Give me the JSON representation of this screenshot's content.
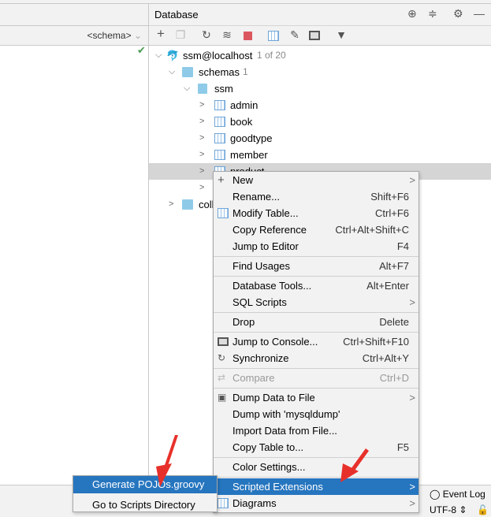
{
  "left": {
    "schema_selector": "<schema>"
  },
  "database": {
    "title": "Database",
    "tree": [
      {
        "label": "ssm@localhost",
        "meta": "1 of 20",
        "level": 0,
        "expanded": true,
        "icon": "mysql-icon"
      },
      {
        "label": "schemas",
        "meta": "1",
        "level": 1,
        "expanded": true,
        "icon": "folder-icon"
      },
      {
        "label": "ssm",
        "level": 2,
        "expanded": true,
        "icon": "schema-icon"
      },
      {
        "label": "admin",
        "level": 3,
        "icon": "table-icon"
      },
      {
        "label": "book",
        "level": 3,
        "icon": "table-icon"
      },
      {
        "label": "goodtype",
        "level": 3,
        "icon": "table-icon"
      },
      {
        "label": "member",
        "level": 3,
        "icon": "table-icon"
      },
      {
        "label": "product",
        "level": 3,
        "icon": "table-icon",
        "selected": true
      },
      {
        "label": "",
        "level": 3,
        "icon": "table-icon"
      },
      {
        "label": "coll",
        "level": 1,
        "icon": "folder-icon"
      }
    ]
  },
  "context_menu": [
    {
      "label": "New",
      "submenu": true,
      "icon": "plus-icon"
    },
    {
      "label": "Rename...",
      "shortcut": "Shift+F6"
    },
    {
      "label": "Modify Table...",
      "shortcut": "Ctrl+F6",
      "icon": "table-icon"
    },
    {
      "label": "Copy Reference",
      "shortcut": "Ctrl+Alt+Shift+C"
    },
    {
      "label": "Jump to Editor",
      "shortcut": "F4"
    },
    {
      "label": "Find Usages",
      "shortcut": "Alt+F7",
      "sep_before": true
    },
    {
      "label": "Database Tools...",
      "shortcut": "Alt+Enter",
      "sep_before": true
    },
    {
      "label": "SQL Scripts",
      "submenu": true
    },
    {
      "label": "Drop",
      "shortcut": "Delete",
      "sep_before": true
    },
    {
      "label": "Jump to Console...",
      "shortcut": "Ctrl+Shift+F10",
      "icon": "console-icon",
      "sep_before": true
    },
    {
      "label": "Synchronize",
      "shortcut": "Ctrl+Alt+Y",
      "icon": "sync-icon"
    },
    {
      "label": "Compare",
      "shortcut": "Ctrl+D",
      "disabled": true,
      "icon": "compare-icon",
      "sep_before": true
    },
    {
      "label": "Dump Data to File",
      "submenu": true,
      "icon": "save-icon",
      "sep_before": true
    },
    {
      "label": "Dump with 'mysqldump'"
    },
    {
      "label": "Import Data from File..."
    },
    {
      "label": "Copy Table to...",
      "shortcut": "F5"
    },
    {
      "label": "Color Settings...",
      "sep_before": true
    },
    {
      "label": "Scripted Extensions",
      "submenu": true,
      "highlighted": true,
      "sep_before": true
    },
    {
      "label": "Diagrams",
      "submenu": true,
      "icon": "diagram-icon"
    }
  ],
  "submenu": [
    {
      "label": "Generate POJOs.groovy",
      "highlighted": true
    },
    {
      "label": "Go to Scripts Directory"
    }
  ],
  "status": {
    "event_log": "Event Log",
    "encoding": "UTF-8",
    "extra": "n/a"
  },
  "colors": {
    "highlight": "#2675bf",
    "arrow": "#e8302a"
  }
}
